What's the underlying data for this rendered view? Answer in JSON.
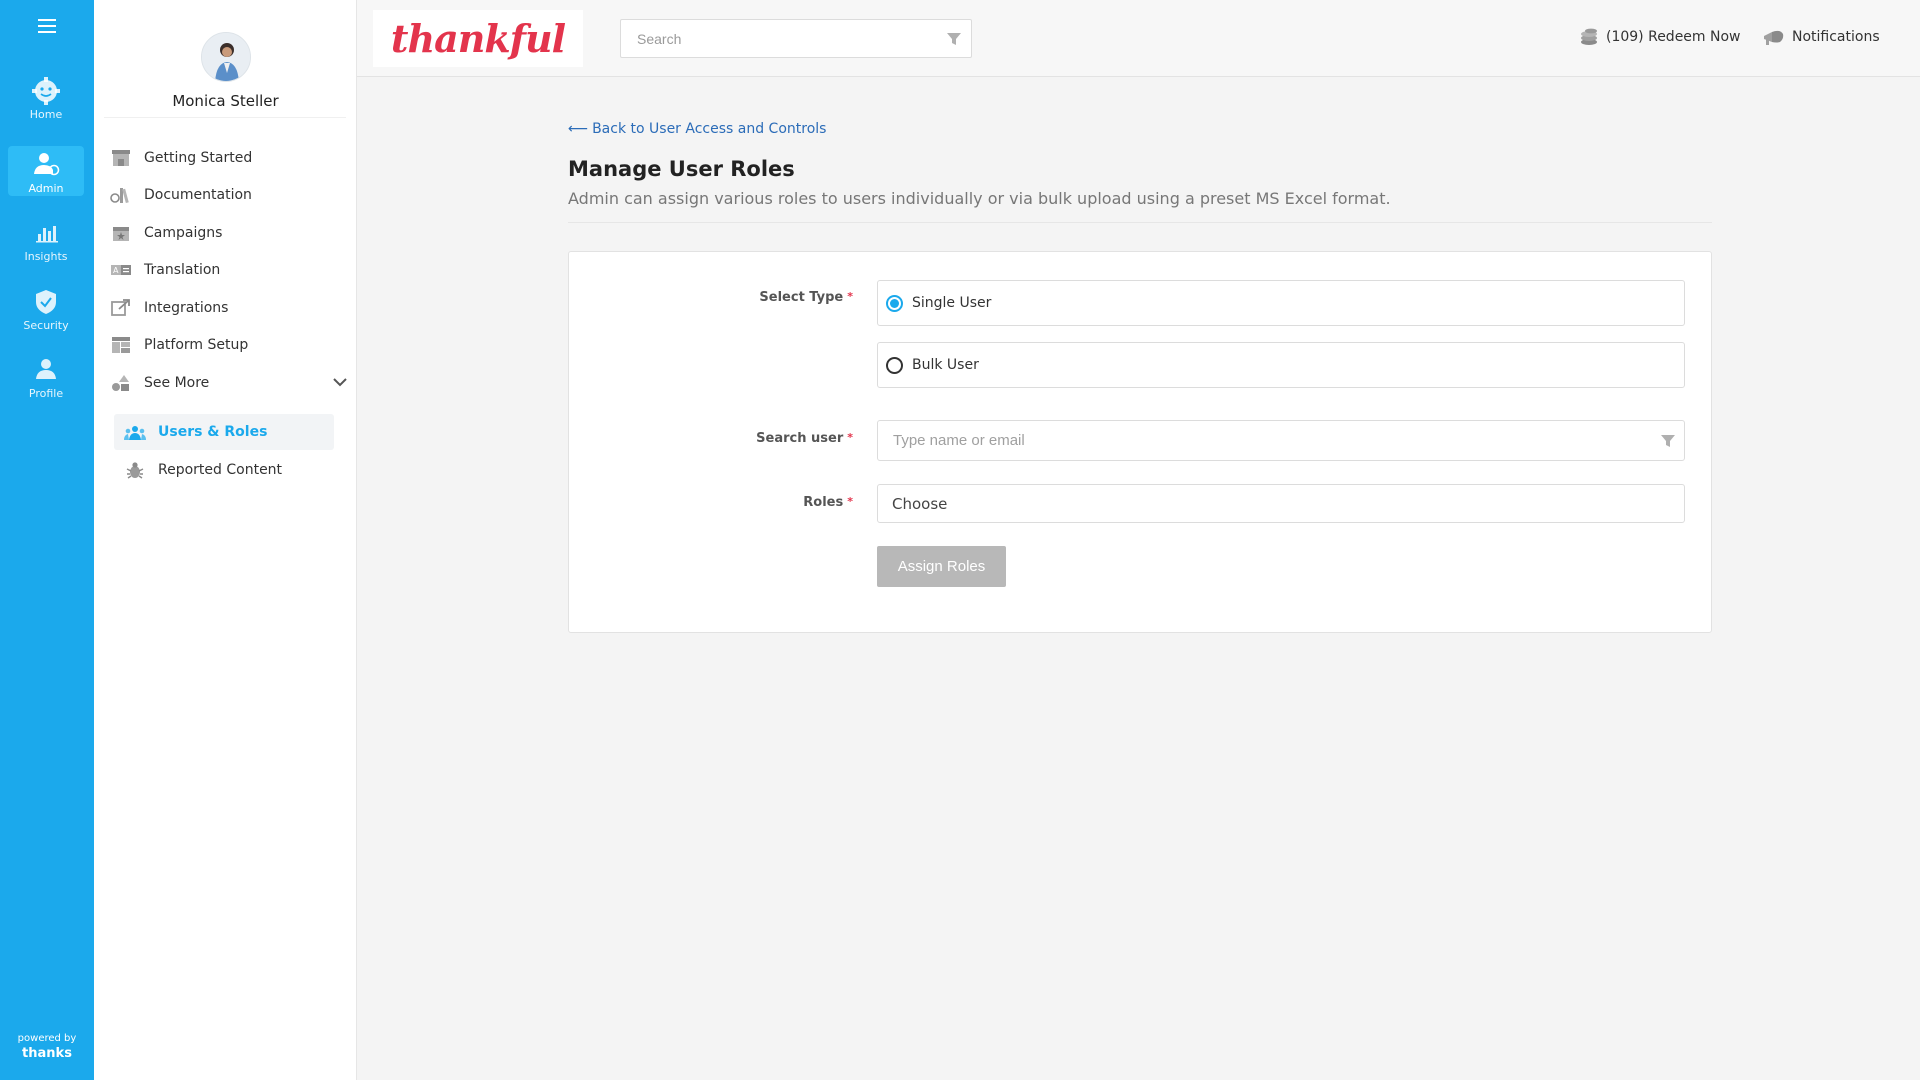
{
  "rail": {
    "items": [
      {
        "label": "Home",
        "icon": "gear-icon"
      },
      {
        "label": "Admin",
        "icon": "admin-user-icon",
        "active": true
      },
      {
        "label": "Insights",
        "icon": "bar-chart-icon"
      },
      {
        "label": "Security",
        "icon": "shield-check-icon"
      },
      {
        "label": "Profile",
        "icon": "person-icon"
      }
    ],
    "powered_by": "powered by",
    "brand": "thanks"
  },
  "sidebar": {
    "user_name": "Monica Steller",
    "items": [
      {
        "label": "Getting Started",
        "icon": "storefront-icon"
      },
      {
        "label": "Documentation",
        "icon": "documents-icon"
      },
      {
        "label": "Campaigns",
        "icon": "calendar-star-icon"
      },
      {
        "label": "Translation",
        "icon": "translate-icon"
      },
      {
        "label": "Integrations",
        "icon": "external-link-icon"
      },
      {
        "label": "Platform Setup",
        "icon": "layout-icon"
      },
      {
        "label": "See More",
        "icon": "shapes-icon"
      }
    ],
    "sub_items": [
      {
        "label": "Users & Roles",
        "icon": "users-group-icon",
        "active": true
      },
      {
        "label": "Reported Content",
        "icon": "bug-icon"
      }
    ]
  },
  "header": {
    "logo_text": "thankful",
    "search_placeholder": "Search",
    "redeem_label": "(109) Redeem Now",
    "notifications_label": "Notifications"
  },
  "main": {
    "back_link": "Back to User Access and Controls",
    "title": "Manage User Roles",
    "description": "Admin can assign various roles to users individually or via bulk upload using a preset MS Excel format.",
    "form": {
      "select_type_label": "Select Type",
      "options": [
        {
          "label": "Single User",
          "checked": true
        },
        {
          "label": "Bulk User",
          "checked": false
        }
      ],
      "search_user_label": "Search user",
      "search_user_placeholder": "Type name or email",
      "roles_label": "Roles",
      "roles_value": "Choose",
      "required_mark": "*",
      "submit_label": "Assign Roles"
    }
  },
  "colors": {
    "primary": "#1ba9ec",
    "brand_red": "#e3344c",
    "link": "#2b6cb8",
    "disabled_button": "#b8b8b8"
  }
}
